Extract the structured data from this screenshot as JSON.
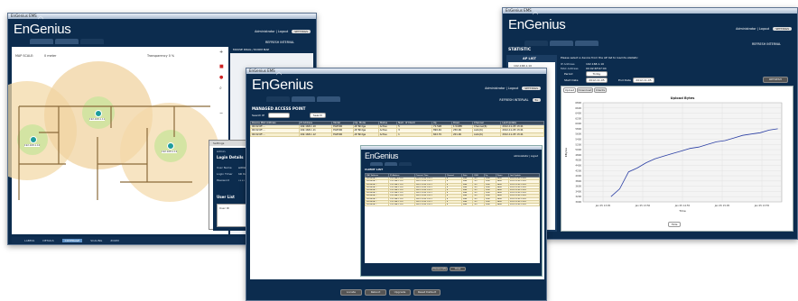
{
  "brand": {
    "logo_text": "EnGenius",
    "logo_mark": "®",
    "wifi_glyph": "◠",
    "accent": "#0c2c4e",
    "gold": "#f3d9a8"
  },
  "left": {
    "title": "EnGenius EMS",
    "header_right": "Administrator | Logout",
    "header_button": "SETTINGS",
    "refresh": "REFRESH INTERVAL",
    "map_scale": "MAP SCALE:",
    "scale_value": "0 meter",
    "transparency": "Transparency 0 %",
    "panel_title": "MOUSE DRAG / ROOM MAP",
    "ap_labels": [
      "192.168.1.10",
      "192.168.1.11",
      "192.168.1.12"
    ],
    "settings": {
      "title": "Settings",
      "section": "Login Details",
      "rows": [
        "Admin",
        "User Name",
        "Login Timer",
        "Password"
      ],
      "row_values": [
        "",
        "admin",
        "10 min",
        "••••"
      ],
      "user_list": "User List",
      "user_field": "User ID"
    },
    "nav": [
      "LABELS",
      "DETAILS",
      "COVERAGE",
      "SCALING",
      "ZOOM"
    ],
    "nav_active": 2
  },
  "middle": {
    "title": "EnGenius EMS",
    "header_right": "Administrator | Logout",
    "header_button": "SETTINGS",
    "refresh": "REFRESH INTERVAL",
    "refresh_value": "5s",
    "heading": "MANAGED ACCESS POINT",
    "search_label": "Search IP",
    "search_placeholder": "",
    "search_button": "Search",
    "columns": [
      "Device MAC Address",
      "IP Address",
      "Model",
      "Op. Mode",
      "Status",
      "Num. of Client",
      "Up",
      "Down",
      "Channel",
      "Last Update"
    ],
    "rows": [
      [
        "00:02:6F:...",
        "192.168.1.10",
        "EAP300",
        "AP Bridge",
        "Active",
        "5",
        "71.5kB",
        "1.54MB",
        "Channel(6)",
        "2012-11-05 13:41"
      ],
      [
        "00:02:6F:...",
        "192.168.1.11",
        "EAP300",
        "AP Bridge",
        "Active",
        "3",
        "890.4K",
        "250.0K",
        "Auto(6)",
        "2012-11-05 13:41"
      ],
      [
        "00:02:6F:...",
        "192.168.1.12",
        "EAP300",
        "AP Bridge",
        "Active",
        "1",
        "602.7K",
        "201.0K",
        "Auto(6)",
        "2012-11-05 13:41"
      ]
    ],
    "footer_buttons": [
      "Locate",
      "Reboot",
      "Upgrade",
      "Reset Default"
    ],
    "nested": {
      "header_right": "Administrator | Logout",
      "heading": "CLIENT LIST",
      "columns": [
        "MAC Address",
        "IP Address",
        "Connect Time",
        "Channel",
        "Rate",
        "RSSI",
        "Up",
        "Down",
        "Last Update"
      ],
      "row": [
        "00:1A:2B:...",
        "192.168.1.101",
        "2012-11-05 13:21",
        "6",
        "54M",
        "-52",
        "120K",
        "340K",
        "2012-11-05 13:41"
      ],
      "row_count": 10,
      "buttons": [
        "Disassociate",
        "Close"
      ]
    }
  },
  "right": {
    "title": "EnGenius EMS",
    "header_right": "Administrator | Logout",
    "header_button": "SETTINGS",
    "refresh": "REFRESH INTERVAL",
    "heading": "STATISTIC",
    "ap_list_title": "AP LIST",
    "ap_list_items": [
      "192.168.1.10",
      "192.168.1.11",
      "192.168.1.12"
    ],
    "instruction": "Please select a device from the AP list to load its statistic",
    "ip_label": "IP Address",
    "ip_value": "192.168.1.10",
    "mac_label": "MAC Address",
    "mac_value": "00:02:6F:67:04",
    "period_label": "Period",
    "period_value": "Today",
    "start_label": "Start Date",
    "start_value": "2012-11-05",
    "end_label": "End Date",
    "end_value": "2012-11-05",
    "refresh_button": "REFRESH",
    "chart_tabs": [
      "Upload",
      "Download",
      "Clients"
    ],
    "chart_tab_active": 0,
    "toggle_button": "Hide"
  },
  "chart_data": {
    "type": "line",
    "title": "Upload Bytes",
    "xlabel": "Time",
    "ylabel": "KBytes",
    "x": [
      "Jan 05 13:05",
      "Jan 05 13:50",
      "Jan 05 14:55",
      "Jan 05 15:05",
      "Jan 05 13:55"
    ],
    "y_ticks": [
      3000,
      3200,
      3400,
      3600,
      3800,
      4000,
      4200,
      4400,
      4600,
      4800,
      5000,
      5200,
      5400,
      5600,
      5800,
      6000,
      6200,
      6400,
      6600,
      6800
    ],
    "ylim": [
      3000,
      6800
    ],
    "series": [
      {
        "values": [
          3200,
          3500,
          4150,
          4300,
          4500,
          4650,
          4750,
          4850,
          4950,
          5050,
          5100,
          5200,
          5300,
          5350,
          5450,
          5550,
          5600,
          5650,
          5750,
          5800
        ]
      }
    ],
    "grid": true,
    "color": "#2b3fa4"
  }
}
